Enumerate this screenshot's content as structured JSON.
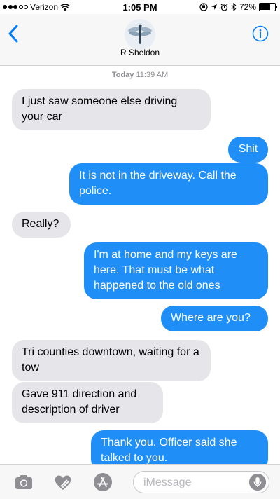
{
  "status_bar": {
    "carrier": "Verizon",
    "time": "1:05 PM",
    "battery": "72%",
    "battery_level": 0.72,
    "icons": [
      "signal-dots-icon",
      "wifi-icon",
      "lock-rotation-icon",
      "location-arrow-icon",
      "alarm-icon",
      "bluetooth-icon",
      "battery-icon"
    ]
  },
  "header": {
    "contact_name": "R Sheldon",
    "back_icon": "chevron-left-icon",
    "info_icon": "info-icon",
    "avatar": "dragonfly-avatar"
  },
  "conversation": {
    "timestamp_day": "Today",
    "timestamp_time": "11:39 AM",
    "messages": [
      {
        "from": "them",
        "text": "I just saw someone else driving your car"
      },
      {
        "from": "me",
        "text": "Shit"
      },
      {
        "from": "me",
        "text": "It is not in the driveway. Call the police."
      },
      {
        "from": "them",
        "text": "Really?"
      },
      {
        "from": "me",
        "text": "I'm at home and my keys are here. That must be what happened to the old ones"
      },
      {
        "from": "me",
        "text": "Where are you?"
      },
      {
        "from": "them",
        "text": "Tri counties downtown, waiting for a tow"
      },
      {
        "from": "them",
        "text": "Gave 911 direction and description of driver"
      },
      {
        "from": "me",
        "text": "Thank you. Officer said she talked to you."
      }
    ]
  },
  "composer": {
    "placeholder": "iMessage",
    "value": "",
    "buttons": [
      "camera-icon",
      "digital-touch-heart-icon",
      "app-store-icon",
      "microphone-icon"
    ]
  },
  "colors": {
    "outgoing_bubble": "#1f8ef7",
    "incoming_bubble": "#e5e5ea",
    "accent": "#007aff"
  }
}
